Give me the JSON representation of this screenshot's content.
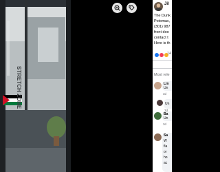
{
  "post": {
    "author": "Jil",
    "lines": [
      "The Dunk",
      "Potomac,",
      "(301) 987",
      "front doo",
      "contact t",
      "Here is th"
    ],
    "reaction_count": "14"
  },
  "viewer": {
    "zoom_label": "zoom",
    "tag_label": "tag"
  },
  "photo": {
    "window_text": "STRETCH ZONE"
  },
  "comments": {
    "section_title": "Most rele",
    "items": [
      {
        "name": "Lin",
        "text": "Un",
        "meta": "3d"
      },
      {
        "name": "",
        "text": "Un",
        "meta": "3d"
      },
      {
        "name": "Ba",
        "text": "Un",
        "meta": "3d"
      }
    ],
    "long": {
      "name": "Sa",
      "lines": [
        "W",
        "fla",
        "or",
        "ho",
        "ac"
      ]
    }
  }
}
